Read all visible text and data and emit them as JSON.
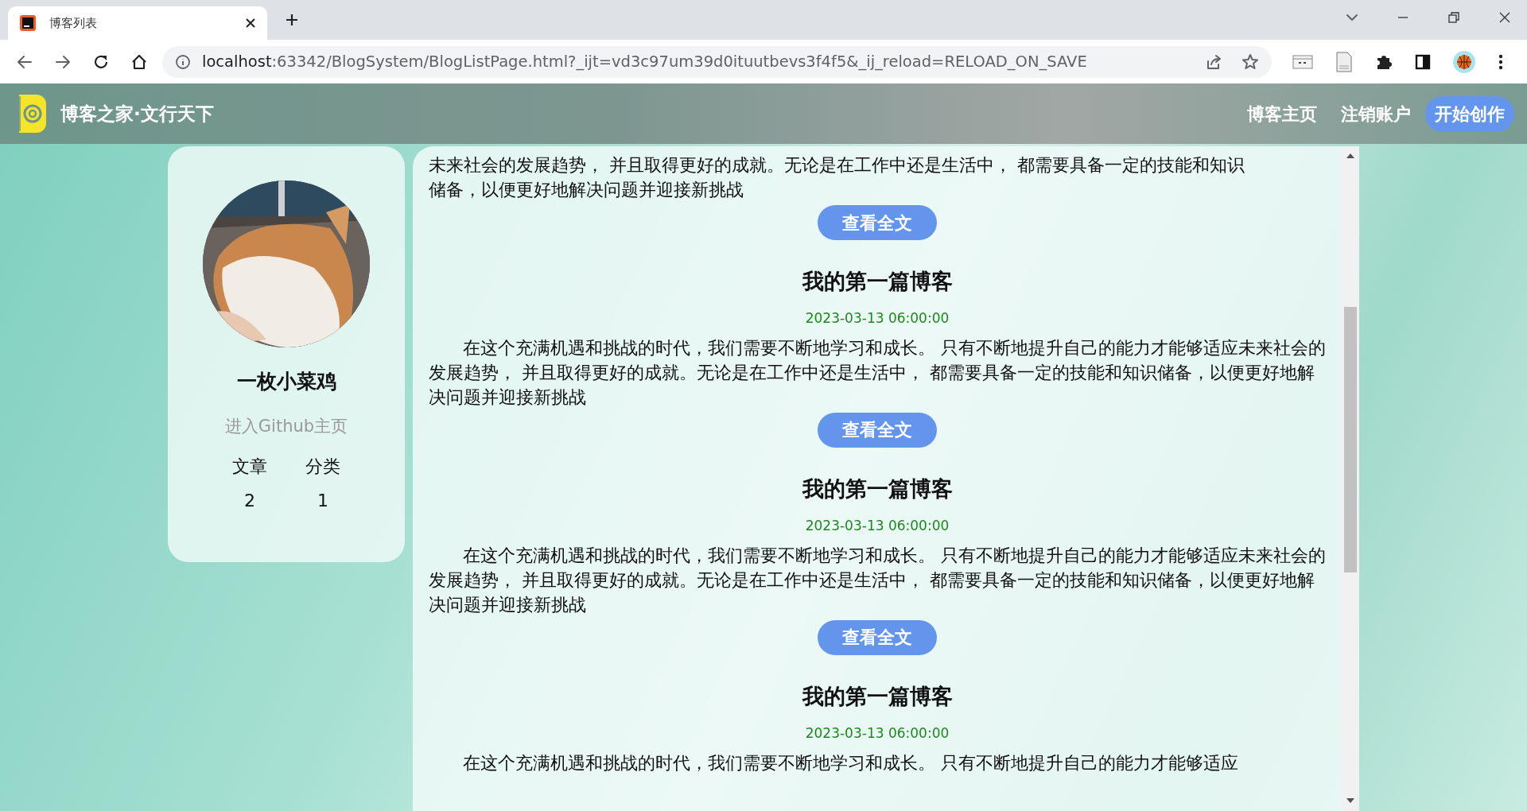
{
  "browser": {
    "tab_title": "博客列表",
    "url_host": "localhost",
    "url_path": ":63342/BlogSystem/BlogListPage.html?_ijt=vd3c97um39d0ituutbevs3f4f5&_ij_reload=RELOAD_ON_SAVE"
  },
  "navbar": {
    "brand": "博客之家·文行天下",
    "links": [
      {
        "label": "博客主页",
        "kind": "link"
      },
      {
        "label": "注销账户",
        "kind": "link"
      },
      {
        "label": "开始创作",
        "kind": "button"
      }
    ]
  },
  "profile": {
    "name": "一枚小菜鸡",
    "github_link": "进入Github主页",
    "stats": [
      {
        "label": "文章",
        "value": "2"
      },
      {
        "label": "分类",
        "value": "1"
      }
    ]
  },
  "posts": [
    {
      "kind": "partial",
      "lines": [
        "未来社会的发展趋势， 并且取得更好的成就。无论是在工作中还是生活中， 都需要具备一定的技能和知识",
        "储备，以便更好地解决问题并迎接新挑战"
      ],
      "button": "查看全文"
    },
    {
      "kind": "full",
      "title": "我的第一篇博客",
      "date": "2023-03-13 06:00:00",
      "body": "在这个充满机遇和挑战的时代，我们需要不断地学习和成长。 只有不断地提升自己的能力才能够适应未来社会的发展趋势， 并且取得更好的成就。无论是在工作中还是生活中， 都需要具备一定的技能和知识储备，以便更好地解决问题并迎接新挑战",
      "button": "查看全文"
    },
    {
      "kind": "full",
      "title": "我的第一篇博客",
      "date": "2023-03-13 06:00:00",
      "body": "在这个充满机遇和挑战的时代，我们需要不断地学习和成长。 只有不断地提升自己的能力才能够适应未来社会的发展趋势， 并且取得更好的成就。无论是在工作中还是生活中， 都需要具备一定的技能和知识储备，以便更好地解决问题并迎接新挑战",
      "button": "查看全文"
    },
    {
      "kind": "full",
      "title": "我的第一篇博客",
      "date": "2023-03-13 06:00:00",
      "body": "在这个充满机遇和挑战的时代，我们需要不断地学习和成长。 只有不断地提升自己的能力才能够适应"
    }
  ]
}
